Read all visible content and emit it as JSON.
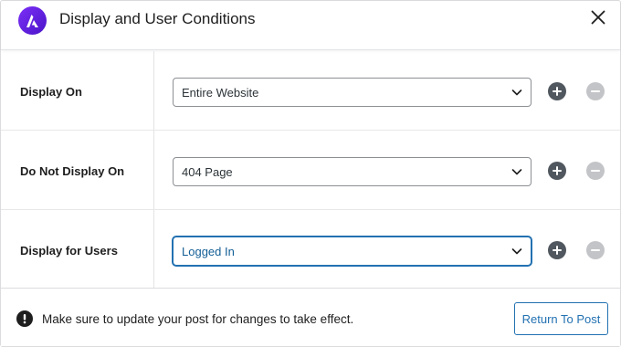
{
  "modal": {
    "title": "Display and User Conditions",
    "accent_color": "#2271b1",
    "logo_colors": [
      "#7b2ff7",
      "#4b14c8"
    ]
  },
  "rows": [
    {
      "label": "Display On",
      "value": "Entire Website"
    },
    {
      "label": "Do Not Display On",
      "value": "404 Page"
    },
    {
      "label": "Display for Users",
      "value": "Logged In"
    }
  ],
  "footer": {
    "notice": "Make sure to update your post for changes to take effect.",
    "return_label": "Return To Post"
  },
  "icons": {
    "logo": "astra-logo-icon",
    "close": "close-icon",
    "dropdown": "chevron-down-icon",
    "add": "plus-circle-icon",
    "remove": "minus-circle-icon",
    "notice": "exclamation-circle-icon"
  }
}
